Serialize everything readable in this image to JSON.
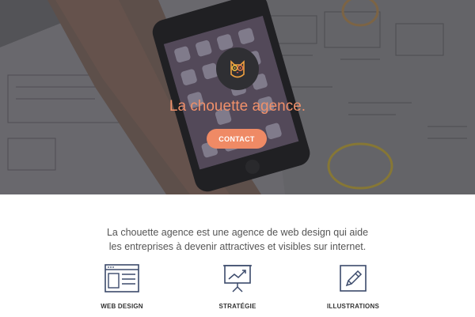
{
  "hero": {
    "title": "La chouette agence.",
    "contact_label": "CONTACT",
    "logo_icon": "owl-logo-icon"
  },
  "intro": {
    "line1": "La chouette agence est une agence de web design qui aide",
    "line2": "les entreprises à devenir attractives et visibles sur internet."
  },
  "services": [
    {
      "label": "WEB DESIGN",
      "icon": "web-design-icon"
    },
    {
      "label": "STRATÉGIE",
      "icon": "strategy-chart-icon"
    },
    {
      "label": "ILLUSTRATIONS",
      "icon": "pencil-illustration-icon"
    }
  ],
  "colors": {
    "accent": "#ef8a65",
    "icon_stroke": "#3b4a6b",
    "text": "#555555"
  }
}
